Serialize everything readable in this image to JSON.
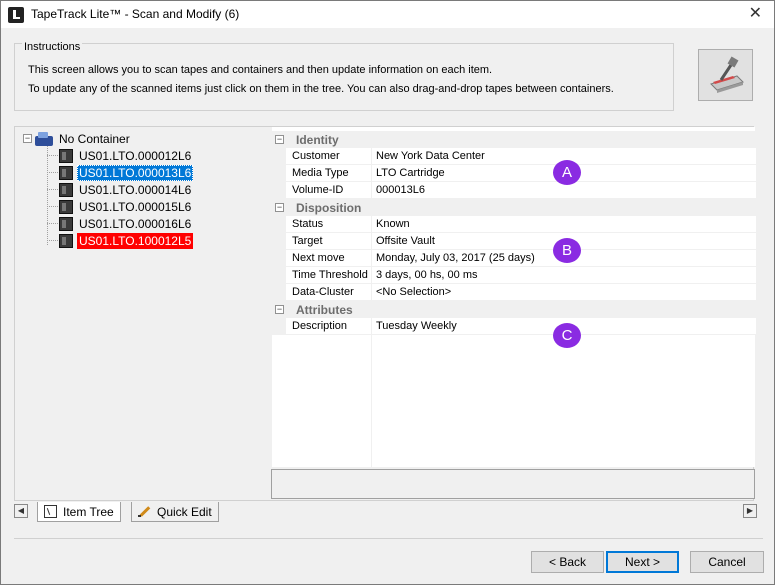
{
  "window": {
    "title": "TapeTrack Lite™ - Scan and Modify (6)",
    "close_glyph": "✕"
  },
  "instructions": {
    "legend": "Instructions",
    "line1": "This screen allows you to scan tapes and containers and then update information on each item.",
    "line2": "To update any of the scanned items just click on them in the tree. You can also drag-and-drop tapes between containers."
  },
  "tree": {
    "root_label": "No Container",
    "items": [
      {
        "label": "US01.LTO.000012L6",
        "state": "normal"
      },
      {
        "label": "US01.LTO.000013L6",
        "state": "selected"
      },
      {
        "label": "US01.LTO.000014L6",
        "state": "normal"
      },
      {
        "label": "US01.LTO.000015L6",
        "state": "normal"
      },
      {
        "label": "US01.LTO.000016L6",
        "state": "normal"
      },
      {
        "label": "US01.LTO.100012L5",
        "state": "alert"
      }
    ]
  },
  "properties": {
    "identity": {
      "label": "Identity",
      "rows": [
        {
          "name": "Customer",
          "value": "New York Data Center"
        },
        {
          "name": "Media Type",
          "value": "LTO Cartridge"
        },
        {
          "name": "Volume-ID",
          "value": "000013L6"
        }
      ]
    },
    "disposition": {
      "label": "Disposition",
      "rows": [
        {
          "name": "Status",
          "value": "Known"
        },
        {
          "name": "Target",
          "value": "Offsite Vault"
        },
        {
          "name": "Next move",
          "value": "Monday, July 03, 2017 (25 days)"
        },
        {
          "name": "Time Threshold",
          "value": "3 days, 00 hs, 00 ms"
        },
        {
          "name": "Data-Cluster",
          "value": "<No Selection>"
        }
      ]
    },
    "attributes": {
      "label": "Attributes",
      "rows": [
        {
          "name": "Description",
          "value": "Tuesday Weekly"
        }
      ]
    },
    "collapse_glyph": "−"
  },
  "badges": {
    "a": "A",
    "b": "B",
    "c": "C",
    "color": "#8a2be2"
  },
  "tabs": {
    "item_tree": "Item Tree",
    "quick_edit": "Quick Edit",
    "scroll_left": "◀",
    "scroll_right": "▶"
  },
  "buttons": {
    "back": "< Back",
    "next": "Next >",
    "cancel": "Cancel"
  },
  "colors": {
    "selected": "#0078d7",
    "alert": "#ff0000"
  }
}
